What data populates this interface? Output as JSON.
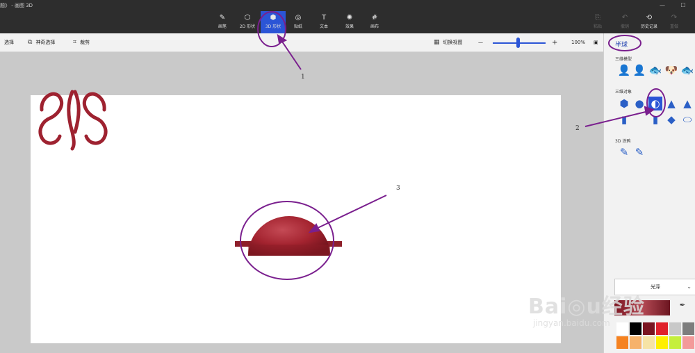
{
  "window": {
    "title": "题》 - 画图 3D",
    "minimize": "—",
    "maximize": "☐"
  },
  "ribbon": {
    "tabs": [
      {
        "label": "画笔",
        "icon": "brush-icon",
        "glyph": "✎"
      },
      {
        "label": "2D 形状",
        "icon": "shapes-2d-icon",
        "glyph": "⬡"
      },
      {
        "label": "3D 形状",
        "icon": "cube-icon",
        "glyph": "⬢",
        "active": true
      },
      {
        "label": "贴纸",
        "icon": "sticker-icon",
        "glyph": "◎"
      },
      {
        "label": "文本",
        "icon": "text-icon",
        "glyph": "T"
      },
      {
        "label": "效果",
        "icon": "sun-icon",
        "glyph": "✺"
      },
      {
        "label": "画布",
        "icon": "canvas-icon",
        "glyph": "#"
      }
    ],
    "right": [
      {
        "label": "粘贴",
        "icon": "paste-icon",
        "glyph": "⎘"
      },
      {
        "label": "撤销",
        "icon": "undo-icon",
        "glyph": "↶"
      },
      {
        "label": "历史记录",
        "icon": "history-icon",
        "glyph": "⟲"
      },
      {
        "label": "重做",
        "icon": "redo-icon",
        "glyph": "↷"
      }
    ]
  },
  "toolbar": {
    "select_label": "选择",
    "magic_select_label": "神奇选择",
    "crop_label": "裁剪",
    "switch_view_label": "切换视图",
    "zoom_minus": "—",
    "zoom_plus": "+",
    "zoom_value": "100%",
    "zoom_fraction": 0.45
  },
  "panel": {
    "title": "半球",
    "section_models": "三维模型",
    "section_objects": "三维对象",
    "section_doodle": "3D 涂鸦",
    "models": [
      "👤",
      "👤",
      "🐟",
      "🐶",
      "🐟"
    ],
    "objects": [
      "⬢",
      "●",
      "◐",
      "▲",
      "▲",
      "▮",
      "▮",
      "◆",
      "⬭"
    ],
    "doodles": [
      "✎",
      "✎"
    ],
    "finish_label": "光泽",
    "finish_chevron": "⌄",
    "eyedropper": "✒",
    "palette": [
      "#ffffff",
      "#000000",
      "#7a1420",
      "#e0202a",
      "#c8c8c8",
      "#7d7d7d",
      "#a8582a",
      "#f39a9a",
      "#f58220",
      "#f6b26b",
      "#f6e3a5",
      "#ffef00",
      "#c5ef3c"
    ]
  },
  "colors": {
    "accent": "#2b55d6",
    "annotation": "#7a1f8e",
    "object": "#a3232f"
  },
  "annotations": {
    "n1": "1",
    "n2": "2",
    "n3": "3"
  },
  "watermark": {
    "logo": "Bai◎u经验",
    "url": "jingyan.baidu.com"
  }
}
